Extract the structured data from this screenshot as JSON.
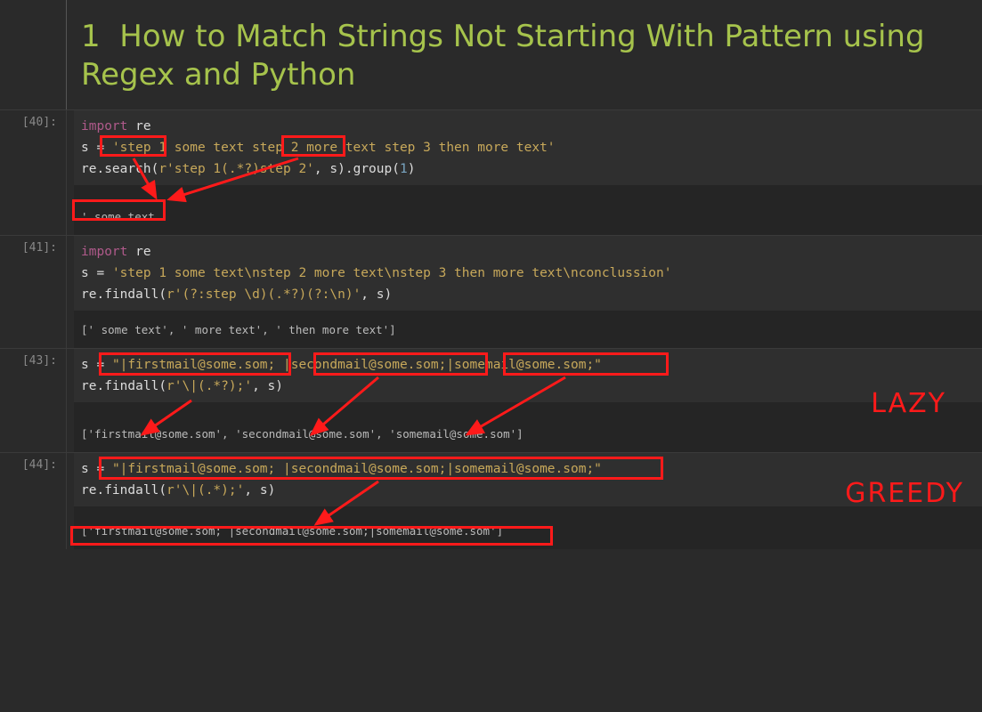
{
  "heading": {
    "number": "1",
    "text": "How to Match Strings Not Starting With Pattern using Regex and Python"
  },
  "cells": [
    {
      "prompt": "[40]:",
      "code": {
        "tokens": [
          [
            {
              "t": "import ",
              "c": "kw"
            },
            {
              "t": "re",
              "c": "op"
            }
          ],
          [
            {
              "t": "s ",
              "c": "op"
            },
            {
              "t": "=",
              "c": "op"
            },
            {
              "t": " ",
              "c": "op"
            },
            {
              "t": "'step 1 some text step 2 more text step 3 then more text'",
              "c": "str"
            }
          ],
          [
            {
              "t": "re.search",
              "c": "fn"
            },
            {
              "t": "(",
              "c": "paren"
            },
            {
              "t": "r",
              "c": "rawprefix"
            },
            {
              "t": "'step 1(.*?)step 2'",
              "c": "str"
            },
            {
              "t": ", s",
              "c": "op"
            },
            {
              "t": ")",
              "c": "paren"
            },
            {
              "t": ".group",
              "c": "fn"
            },
            {
              "t": "(",
              "c": "paren"
            },
            {
              "t": "1",
              "c": "num"
            },
            {
              "t": ")",
              "c": "paren"
            }
          ]
        ]
      },
      "output": "' some text '"
    },
    {
      "prompt": "[41]:",
      "code": {
        "tokens": [
          [
            {
              "t": "import ",
              "c": "kw"
            },
            {
              "t": "re",
              "c": "op"
            }
          ],
          [
            {
              "t": "s ",
              "c": "op"
            },
            {
              "t": "=",
              "c": "op"
            },
            {
              "t": " ",
              "c": "op"
            },
            {
              "t": "'step 1 some text\\nstep 2 more text\\nstep 3 then more text\\nconclussion'",
              "c": "str"
            }
          ],
          [
            {
              "t": "re.findall",
              "c": "fn"
            },
            {
              "t": "(",
              "c": "paren"
            },
            {
              "t": "r",
              "c": "rawprefix"
            },
            {
              "t": "'(?:step \\d)(.*?)(?:\\n)'",
              "c": "str"
            },
            {
              "t": ", s",
              "c": "op"
            },
            {
              "t": ")",
              "c": "paren"
            }
          ]
        ]
      },
      "output": "[' some text', ' more text', ' then more text']"
    },
    {
      "prompt": "[43]:",
      "code": {
        "tokens": [
          [
            {
              "t": "s ",
              "c": "op"
            },
            {
              "t": "=",
              "c": "op"
            },
            {
              "t": " ",
              "c": "op"
            },
            {
              "t": "\"|firstmail@some.som; |secondmail@some.som;|somemail@some.som;\"",
              "c": "str"
            }
          ],
          [
            {
              "t": "re.findall",
              "c": "fn"
            },
            {
              "t": "(",
              "c": "paren"
            },
            {
              "t": "r",
              "c": "rawprefix"
            },
            {
              "t": "'\\|(.*?);'",
              "c": "str"
            },
            {
              "t": ", s",
              "c": "op"
            },
            {
              "t": ")",
              "c": "paren"
            }
          ]
        ]
      },
      "output": "['firstmail@some.som', 'secondmail@some.som', 'somemail@some.som']",
      "label": "LAZY"
    },
    {
      "prompt": "[44]:",
      "code": {
        "tokens": [
          [
            {
              "t": "s ",
              "c": "op"
            },
            {
              "t": "=",
              "c": "op"
            },
            {
              "t": " ",
              "c": "op"
            },
            {
              "t": "\"|firstmail@some.som; |secondmail@some.som;|somemail@some.som;\"",
              "c": "str"
            }
          ],
          [
            {
              "t": "re.findall",
              "c": "fn"
            },
            {
              "t": "(",
              "c": "paren"
            },
            {
              "t": "r",
              "c": "rawprefix"
            },
            {
              "t": "'\\|(.*);'",
              "c": "str"
            },
            {
              "t": ", s",
              "c": "op"
            },
            {
              "t": ")",
              "c": "paren"
            }
          ]
        ]
      },
      "output": "['firstmail@some.som; |secondmail@some.som;|somemail@some.som']",
      "label": "GREEDY"
    }
  ]
}
